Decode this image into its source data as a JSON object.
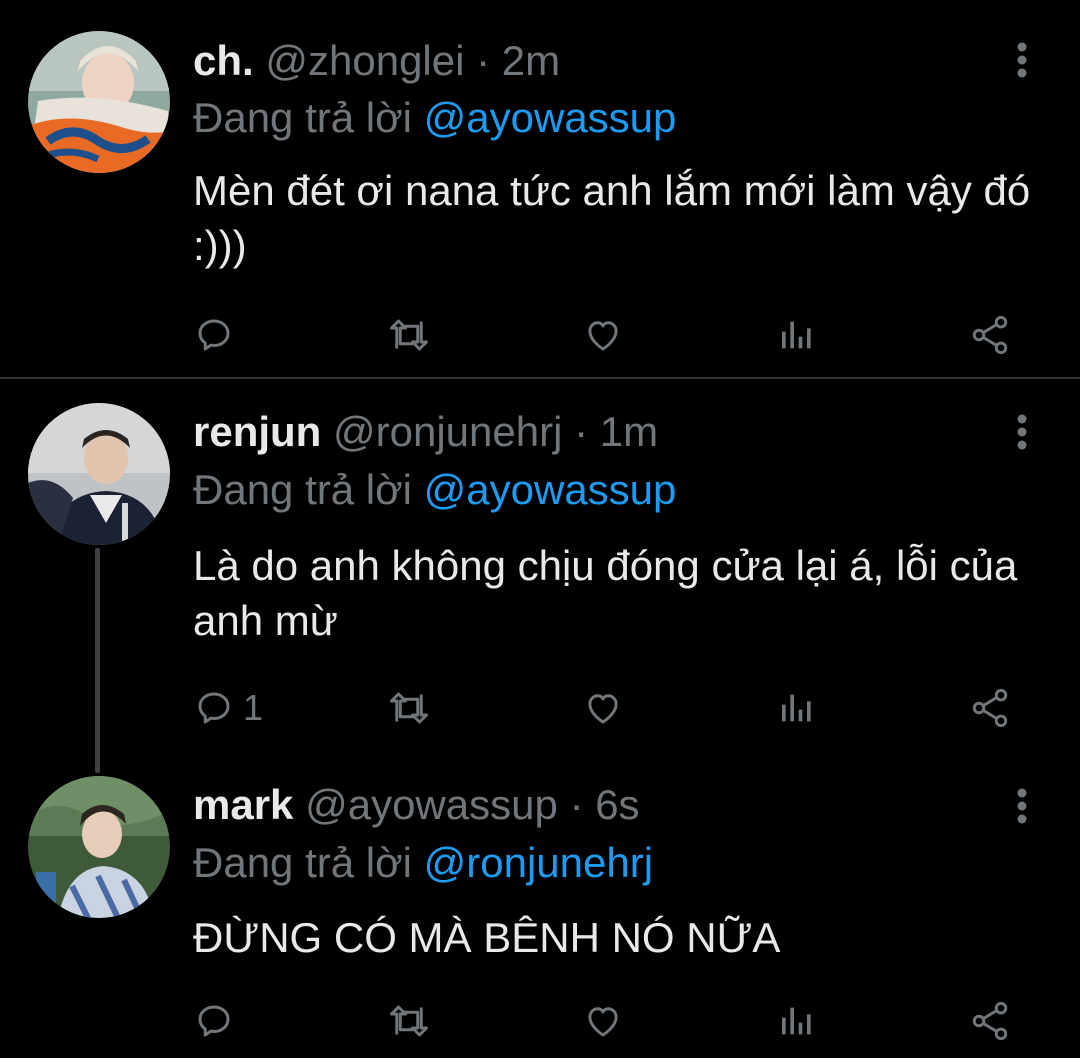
{
  "tweets": [
    {
      "display_name": "ch.",
      "handle": "@zhonglei",
      "separator": "·",
      "time": "2m",
      "reply_prefix": "Đang trả lời",
      "reply_to": "@ayowassup",
      "text": "Mèn đét ơi nana tức anh lắm mới làm vậy đó :)))",
      "reply_count": ""
    },
    {
      "display_name": "renjun",
      "handle": "@ronjunehrj",
      "separator": "·",
      "time": "1m",
      "reply_prefix": "Đang trả lời",
      "reply_to": "@ayowassup",
      "text": "Là do anh không chịu đóng cửa lại á, lỗi của anh mừ",
      "reply_count": "1"
    },
    {
      "display_name": "mark",
      "handle": "@ayowassup",
      "separator": "·",
      "time": "6s",
      "reply_prefix": "Đang trả lời",
      "reply_to": "@ronjunehrj",
      "text": "ĐỪNG CÓ MÀ BÊNH NÓ NỮA",
      "reply_count": ""
    }
  ],
  "icons": {
    "reply": "reply-icon",
    "retweet": "retweet-icon",
    "like": "heart-icon",
    "analytics": "analytics-icon",
    "share": "share-icon",
    "more": "more-vertical-icon"
  },
  "colors": {
    "background": "#000000",
    "text_primary": "#e7e9ea",
    "text_secondary": "#71767b",
    "accent": "#1d9bf0",
    "divider": "#2f3336"
  }
}
